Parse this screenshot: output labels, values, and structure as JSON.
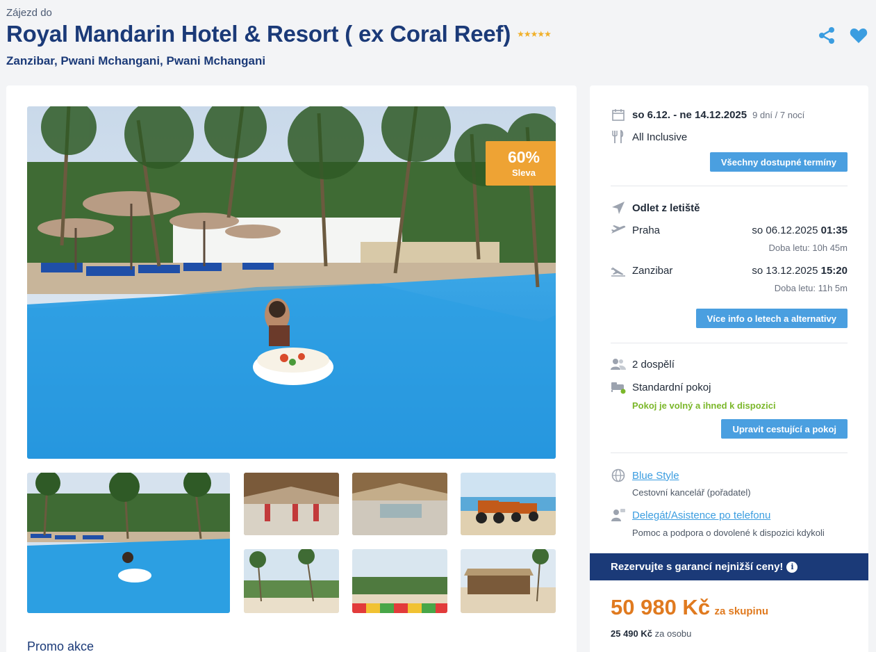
{
  "header": {
    "subtitle": "Zájezd do",
    "hotel_name": "Royal Mandarin Hotel & Resort ( ex Coral Reef)",
    "stars": "★★★★★",
    "location": "Zanzibar, Pwani Mchangani, Pwani Mchangani",
    "icons": [
      "share-icon",
      "heart-icon"
    ]
  },
  "gallery": {
    "discount_pct": "60%",
    "discount_label": "Sleva",
    "promo_heading": "Promo akce"
  },
  "booking": {
    "dates": "so 6.12. - ne 14.12.2025",
    "duration": "9 dní / 7 nocí",
    "board": "All Inclusive",
    "all_dates_button": "Všechny dostupné termíny",
    "departure_heading": "Odlet z letiště",
    "outbound": {
      "city": "Praha",
      "date": "so 06.12.2025",
      "time": "01:35",
      "duration": "Doba letu: 10h 45m"
    },
    "inbound": {
      "city": "Zanzibar",
      "date": "so 13.12.2025",
      "time": "15:20",
      "duration": "Doba letu: 11h 5m"
    },
    "flight_info_button": "Více info o letech a alternativy",
    "travelers": "2 dospělí",
    "room": "Standardní pokoj",
    "room_status": "Pokoj je volný a ihned k dispozici",
    "edit_button": "Upravit cestující a pokoj",
    "agency_link": "Blue Style",
    "agency_desc": "Cestovní kancelář (pořadatel)",
    "support_link": "Delegát/Asistence po telefonu",
    "support_desc": "Pomoc a podpora o dovolené k dispozici kdykoli",
    "guarantee_banner": "Rezervujte s garancí nejnižší ceny!",
    "info_icon_glyph": "i",
    "price": "50 980 Kč",
    "price_suffix": "za skupinu",
    "per_person_price": "25 490 Kč",
    "per_person_suffix": "za osobu"
  },
  "colors": {
    "brand_navy": "#1b3a78",
    "accent_blue": "#4a9fe0",
    "price_orange": "#e07a1f",
    "discount_orange": "#eea334",
    "available_green": "#7bb72a"
  }
}
